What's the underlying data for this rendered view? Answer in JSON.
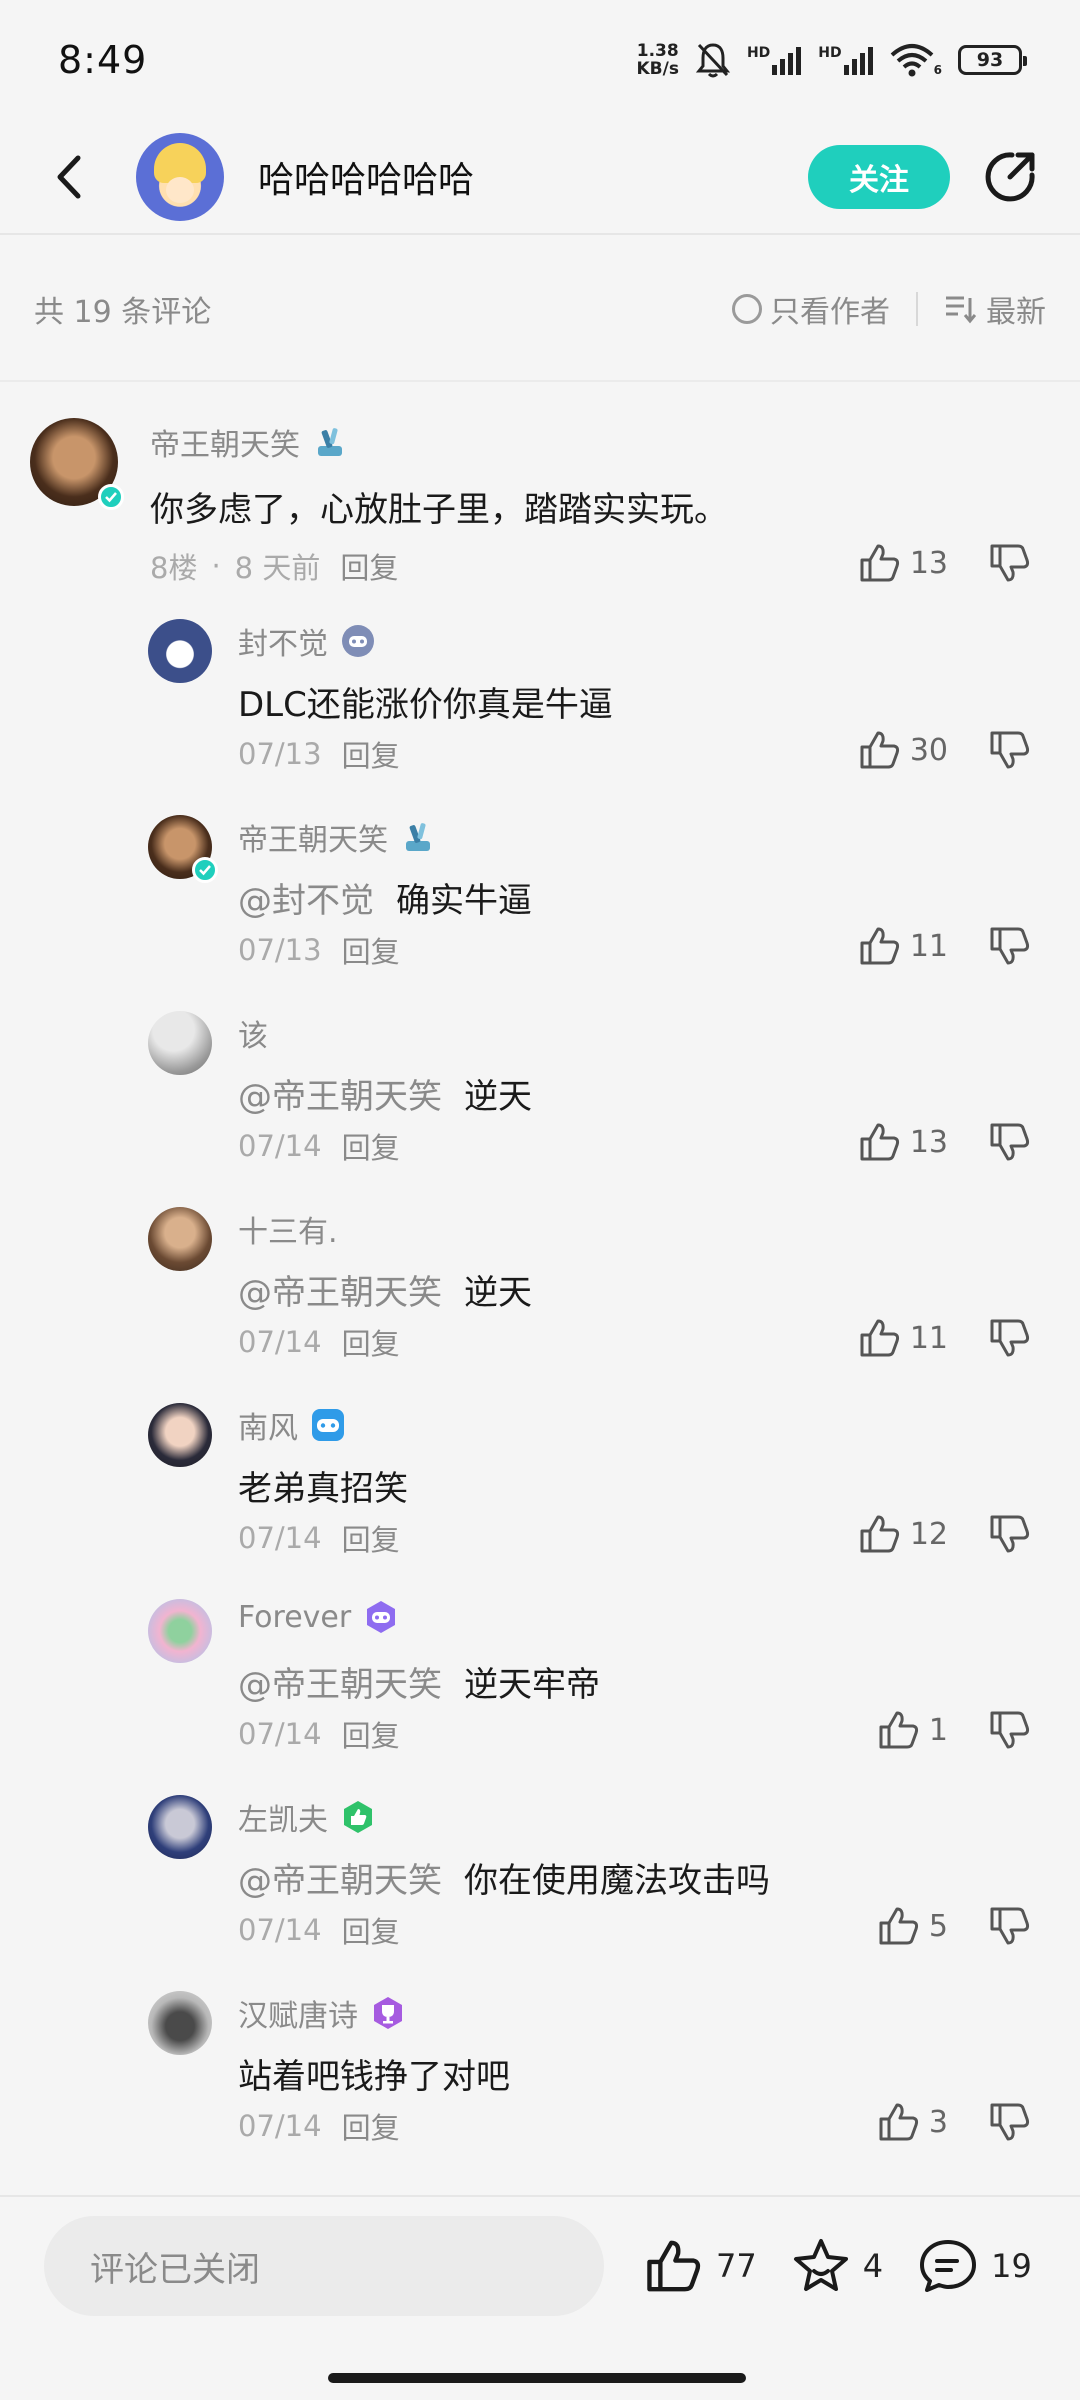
{
  "status_bar": {
    "time": "8:49",
    "net_speed_value": "1.38",
    "net_speed_unit": "KB/s",
    "signal_1_label": "HD",
    "signal_2_label": "HD",
    "wifi_sub": "6",
    "battery": "93"
  },
  "header": {
    "title": "哈哈哈哈哈哈",
    "follow_label": "关注",
    "accent": "#1fcfbd"
  },
  "filter": {
    "count_text": "共 19 条评论",
    "author_only_label": "只看作者",
    "sort_label": "最新"
  },
  "main_comment": {
    "user": "帝王朝天笑",
    "text": "你多虑了，心放肚子里，踏踏实实玩。",
    "floor": "8楼",
    "dot": "·",
    "time": "8 天前",
    "reply_label": "回复",
    "likes": "13"
  },
  "replies": [
    {
      "user": "封不觉",
      "mention": "",
      "text": "DLC还能涨价你真是牛逼",
      "date": "07/13",
      "reply_label": "回复",
      "likes": "30",
      "badge": "controller-badge-icon"
    },
    {
      "user": "帝王朝天笑",
      "mention": "@封不觉",
      "text": "确实牛逼",
      "date": "07/13",
      "reply_label": "回复",
      "likes": "11",
      "badge": "robot-badge-icon"
    },
    {
      "user": "该",
      "mention": "@帝王朝天笑",
      "text": "逆天",
      "date": "07/14",
      "reply_label": "回复",
      "likes": "13",
      "badge": ""
    },
    {
      "user": "十三有.",
      "mention": "@帝王朝天笑",
      "text": "逆天",
      "date": "07/14",
      "reply_label": "回复",
      "likes": "11",
      "badge": ""
    },
    {
      "user": "南风",
      "mention": "",
      "text": "老弟真招笑",
      "date": "07/14",
      "reply_label": "回复",
      "likes": "12",
      "badge": "gamepad-blue-badge-icon"
    },
    {
      "user": "Forever",
      "mention": "@帝王朝天笑",
      "text": "逆天牢帝",
      "date": "07/14",
      "reply_label": "回复",
      "likes": "1",
      "badge": "gamepad-purple-badge-icon"
    },
    {
      "user": "左凯夫",
      "mention": "@帝王朝天笑",
      "text": "你在使用魔法攻击吗",
      "date": "07/14",
      "reply_label": "回复",
      "likes": "5",
      "badge": "thumb-green-badge-icon"
    },
    {
      "user": "汉赋唐诗",
      "mention": "",
      "text": "站着吧钱挣了对吧",
      "date": "07/14",
      "reply_label": "回复",
      "likes": "3",
      "badge": "trophy-purple-badge-icon"
    }
  ],
  "bottom": {
    "closed_text": "评论已关闭",
    "likes": "77",
    "favorites": "4",
    "comments": "19"
  }
}
